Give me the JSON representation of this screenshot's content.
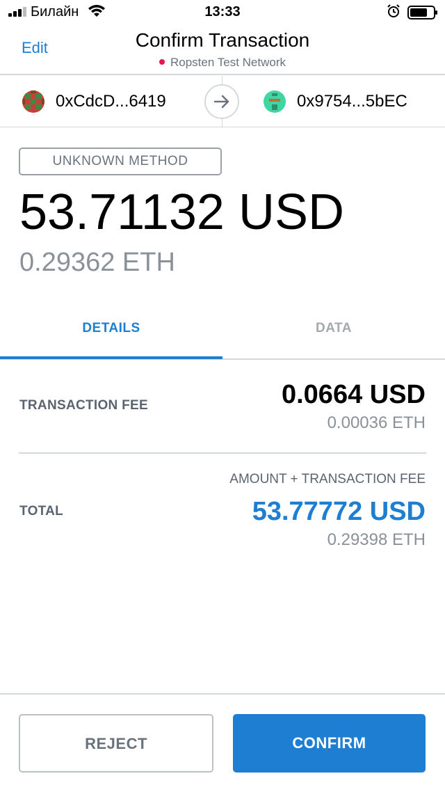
{
  "status_bar": {
    "carrier": "Билайн",
    "time": "13:33",
    "icons": [
      "signal-icon",
      "wifi-icon",
      "alarm-icon",
      "battery-icon"
    ]
  },
  "header": {
    "edit_label": "Edit",
    "title": "Confirm Transaction",
    "network": "Ropsten Test Network",
    "network_dot_color": "#e91550"
  },
  "accounts": {
    "from": "0xCdcD...6419",
    "to": "0x9754...5bEC",
    "arrow_icon": "arrow-right-icon"
  },
  "transaction": {
    "method": "UNKNOWN METHOD",
    "amount_primary": "53.71132 USD",
    "amount_secondary": "0.29362 ETH"
  },
  "tabs": [
    {
      "label": "DETAILS",
      "active": true
    },
    {
      "label": "DATA",
      "active": false
    }
  ],
  "details": {
    "fee_label": "TRANSACTION FEE",
    "fee_usd": "0.0664 USD",
    "fee_eth": "0.00036 ETH",
    "total_caption": "AMOUNT + TRANSACTION FEE",
    "total_label": "TOTAL",
    "total_usd": "53.77772 USD",
    "total_eth": "0.29398 ETH"
  },
  "buttons": {
    "reject": "REJECT",
    "confirm": "CONFIRM"
  },
  "colors": {
    "accent": "#1d7ed2",
    "muted_text": "#8a9199",
    "border": "#d6d9dc"
  }
}
